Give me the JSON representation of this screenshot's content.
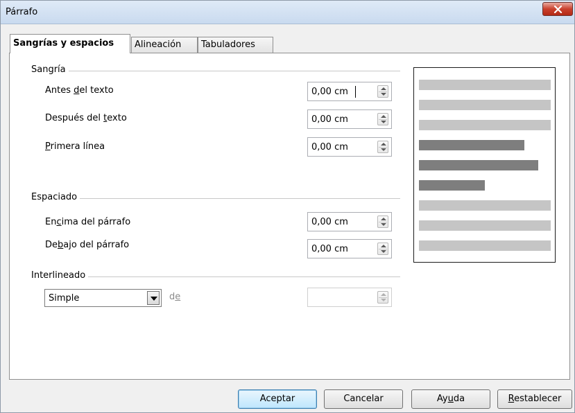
{
  "window": {
    "title": "Párrafo"
  },
  "tabs": [
    {
      "label": "Sangrías y espacios"
    },
    {
      "label": "Alineación"
    },
    {
      "label": "Tabuladores"
    }
  ],
  "indent": {
    "title": "Sangría",
    "before": {
      "pre": "Antes ",
      "key": "d",
      "post": "el texto",
      "value": "0,00 cm"
    },
    "after": {
      "pre": "Después del ",
      "key": "t",
      "post": "exto",
      "value": "0,00 cm"
    },
    "first": {
      "pre": "",
      "key": "P",
      "post": "rimera línea",
      "value": "0,00 cm"
    }
  },
  "spacing": {
    "title": "Espaciado",
    "above": {
      "pre": "En",
      "key": "c",
      "post": "ima del párrafo",
      "value": "0,00 cm"
    },
    "below": {
      "pre": "De",
      "key": "b",
      "post": "ajo del párrafo",
      "value": "0,00 cm"
    }
  },
  "line_spacing": {
    "title": "Interlineado",
    "selected": "Simple",
    "of_pre": "d",
    "of_key": "e",
    "of_value": ""
  },
  "buttons": {
    "ok": "Aceptar",
    "cancel": "Cancelar",
    "help_pre": "Ay",
    "help_key": "u",
    "help_post": "da",
    "reset_key": "R",
    "reset_post": "establecer"
  },
  "colors": {
    "preview_light": "#c5c5c5",
    "preview_dark": "#7e7e7e",
    "close_button": "#c9402d"
  }
}
